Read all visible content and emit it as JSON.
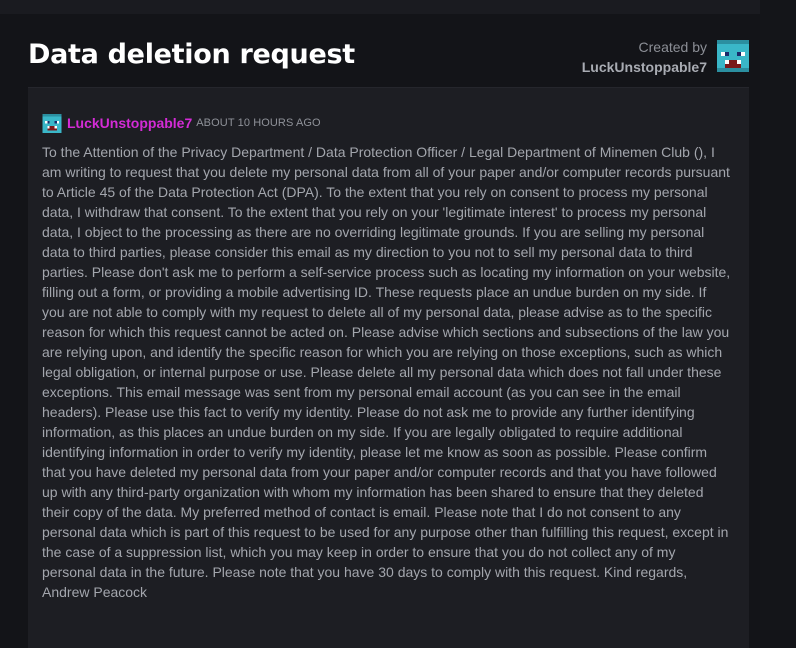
{
  "page": {
    "title": "Data deletion request",
    "created_by_label": "Created by",
    "creator_name": "LuckUnstoppable7",
    "creator_avatar_icon": "minecraft-skin-head-icon"
  },
  "post": {
    "author": "LuckUnstoppable7",
    "author_color": "#d42bd6",
    "timestamp": "ABOUT 10 HOURS AGO",
    "avatar_icon": "minecraft-skin-head-icon",
    "body": "To the Attention of the Privacy Department / Data Protection Officer / Legal Department of Minemen Club (), I am writing to request that you delete my personal data from all of your paper and/or computer records pursuant to Article 45 of the Data Protection Act (DPA). To the extent that you rely on consent to process my personal data, I withdraw that consent. To the extent that you rely on your 'legitimate interest' to process my personal data, I object to the processing as there are no overriding legitimate grounds. If you are selling my personal data to third parties, please consider this email as my direction to you not to sell my personal data to third parties. Please don't ask me to perform a self-service process such as locating my information on your website, filling out a form, or providing a mobile advertising ID. These requests place an undue burden on my side. If you are not able to comply with my request to delete all of my personal data, please advise as to the specific reason for which this request cannot be acted on. Please advise which sections and subsections of the law you are relying upon, and identify the specific reason for which you are relying on those exceptions, such as which legal obligation, or internal purpose or use. Please delete all my personal data which does not fall under these exceptions. This email message was sent from my personal email account (as you can see in the email headers). Please use this fact to verify my identity. Please do not ask me to provide any further identifying information, as this places an undue burden on my side. If you are legally obligated to require additional identifying information in order to verify my identity, please let me know as soon as possible. Please confirm that you have deleted my personal data from your paper and/or computer records and that you have followed up with any third-party organization with whom my information has been shared to ensure that they deleted their copy of the data. My preferred method of contact is email. Please note that I do not consent to any personal data which is part of this request to be used for any purpose other than fulfilling this request, except in the case of a suppression list, which you may keep in order to ensure that you do not collect any of my personal data in the future. Please note that you have 30 days to comply with this request. Kind regards, Andrew Peacock"
  }
}
